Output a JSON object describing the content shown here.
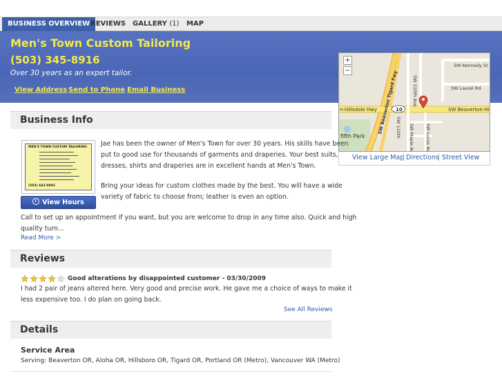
{
  "tabs": [
    {
      "label": "BUSINESS OVERVIEW"
    },
    {
      "label": "REVIEWS"
    },
    {
      "label": "GALLERY",
      "count": "(1)"
    },
    {
      "label": "MAP"
    }
  ],
  "business": {
    "name": "Men's Town Custom Tailoring",
    "phone": "(503) 345-8916",
    "tagline": "Over 30 years as an expert tailor.",
    "links": [
      "View Address",
      "Send to Phone",
      "Email Business"
    ]
  },
  "map": {
    "zoom_in": "+",
    "zoom_out": "−",
    "street_labels": [
      "SW Kennedy St",
      "SW Laurel Rd",
      "SW Beaverton Tigard Fwy",
      "SW 110th Ave",
      "SW Beaverton-Hill",
      "n-Hillsdale Hwy",
      "10",
      "SW 110th",
      "SW Maple Ave",
      "SW Lucas Ave",
      "fifth Park"
    ],
    "links": [
      "View Large Map",
      "Directions",
      "Street View"
    ],
    "separator": "|"
  },
  "business_info": {
    "heading": "Business Info",
    "card": {
      "title": "MEN'S TOWN CUSTOM TAILORING",
      "phone": "(503) 643-8892"
    },
    "view_hours": "View Hours",
    "para1_lines": [
      "Jae has been the owner of Men's Town for over 30 years. His skills have been",
      "put to good use for thousands of garments and draperies. Your best suits,",
      "dresses, shirts and draperies are in excellent hands at Men's Town."
    ],
    "para2_lines": [
      "Bring your ideas for custom clothes made by the best. You will have a wide",
      "variety of fabric to choose from; leather is even an option."
    ],
    "para3_lines": [
      "Call to set up an appointment if you want, but you are welcome to drop in any time also. Quick and high",
      "quality turn..."
    ],
    "read_more": "Read More >"
  },
  "reviews": {
    "heading": "Reviews",
    "rating": 4,
    "max_rating": 5,
    "review_title": "Good alterations by disappointed customer - 03/30/2009",
    "review_lines": [
      "I had 2 pair of jeans altered here. Very good and precise work. He gave me a choice of ways to make it",
      "less expensive too. I do plan on going back."
    ],
    "see_all": "See All Reviews"
  },
  "details": {
    "heading": "Details",
    "service_area_title": "Service Area",
    "serving": "Serving: Beaverton OR, Aloha OR, Hillsboro OR, Tigard OR, Portland OR (Metro), Vancouver WA (Metro)"
  },
  "colors": {
    "accent_blue": "#3f5fa8",
    "hero_blue": "#4a66b6",
    "title_yellow": "#f5e94a",
    "link_blue": "#2a5aa8",
    "star_gold": "#f2c531"
  }
}
